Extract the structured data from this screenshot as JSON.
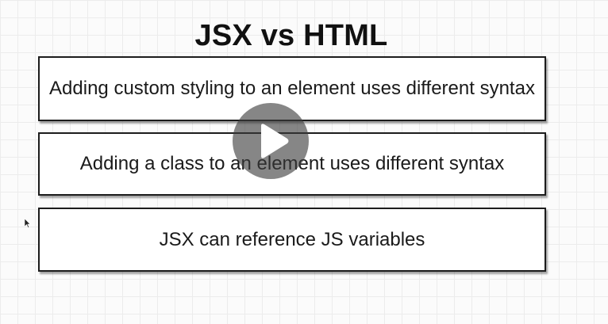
{
  "slide": {
    "title": "JSX vs HTML",
    "cards": [
      {
        "text": "Adding custom styling to an element uses different syntax"
      },
      {
        "text": "Adding a class to an element uses different syntax"
      },
      {
        "text": "JSX can reference JS variables"
      }
    ]
  },
  "player": {
    "play_icon": "play-icon",
    "overlay_color": "#3c3c3c"
  },
  "colors": {
    "card_border": "#1c1c1c",
    "grid_line": "#ececec",
    "background": "#fbfbfb"
  }
}
